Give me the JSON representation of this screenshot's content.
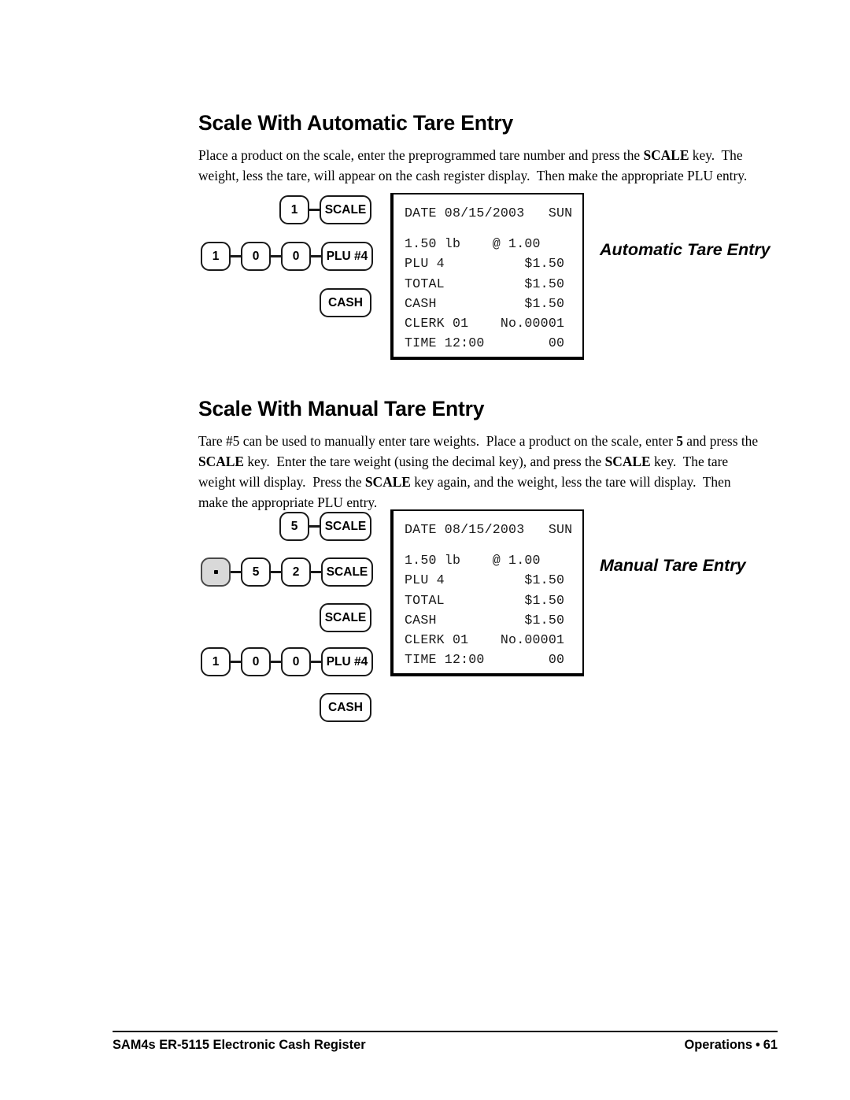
{
  "document": {
    "footer": {
      "left_text": "SAM4s ER-5115 Electronic Cash Register",
      "right_section": "Operations",
      "bullet": "•",
      "page_number": "61"
    }
  },
  "sections": [
    {
      "heading": "Scale With Automatic Tare Entry",
      "paragraph_html": "Place a product on the scale, enter the preprogrammed tare number and press the <b>SCALE</b> key.&nbsp; The weight, less the tare, will appear on the cash register display.&nbsp; Then make the appropriate PLU entry.",
      "callout": "Automatic Tare Entry",
      "key_sequence": [
        {
          "row": 1,
          "keys": [
            "1",
            "SCALE"
          ]
        },
        {
          "row": 2,
          "keys": [
            "1",
            "0",
            "0",
            "PLU #4"
          ]
        },
        {
          "row": 3,
          "keys": [
            "CASH"
          ]
        }
      ],
      "receipt": {
        "lines": [
          "DATE 08/15/2003   SUN",
          "",
          "1.50 lb    @ 1.00",
          "PLU 4          $1.50",
          "TOTAL          $1.50",
          "CASH           $1.50",
          "CLERK 01    No.00001",
          "TIME 12:00        00"
        ]
      }
    },
    {
      "heading": "Scale With Manual Tare Entry",
      "paragraph_html": "Tare #5 can be used to manually enter tare weights.&nbsp; Place a product on the scale, enter <b>5</b> and press the <b>SCALE</b> key.&nbsp; Enter the tare weight (using the decimal key), and press the <b>SCALE</b> key.&nbsp; The tare weight will display.&nbsp; Press the <b>SCALE</b> key again, and the weight, less the tare will display.&nbsp; Then make the appropriate PLU entry.",
      "callout": "Manual Tare Entry",
      "key_sequence": [
        {
          "row": 1,
          "keys": [
            "5",
            "SCALE"
          ]
        },
        {
          "row": 2,
          "keys": [
            ".",
            "5",
            "2",
            "SCALE"
          ]
        },
        {
          "row": 3,
          "keys": [
            "SCALE"
          ]
        },
        {
          "row": 4,
          "keys": [
            "1",
            "0",
            "0",
            "PLU #4"
          ]
        },
        {
          "row": 5,
          "keys": [
            "CASH"
          ]
        }
      ],
      "receipt": {
        "lines": [
          "DATE 08/15/2003   SUN",
          "",
          "1.50 lb    @ 1.00",
          "PLU 4          $1.50",
          "TOTAL          $1.50",
          "CASH           $1.50",
          "CLERK 01    No.00001",
          "TIME 12:00        00"
        ]
      }
    }
  ],
  "key_labels": {
    "one": "1",
    "zero": "0",
    "two": "2",
    "five": "5",
    "decimal": ".",
    "scale": "SCALE",
    "plu4": "PLU #4",
    "cash": "CASH"
  },
  "colors": {
    "ink": "#000000",
    "key_border": "#1a1a1a",
    "key_fill": "#ffffff",
    "key_fill_shaded": "#d9d9d9",
    "page_background": "#ffffff"
  }
}
